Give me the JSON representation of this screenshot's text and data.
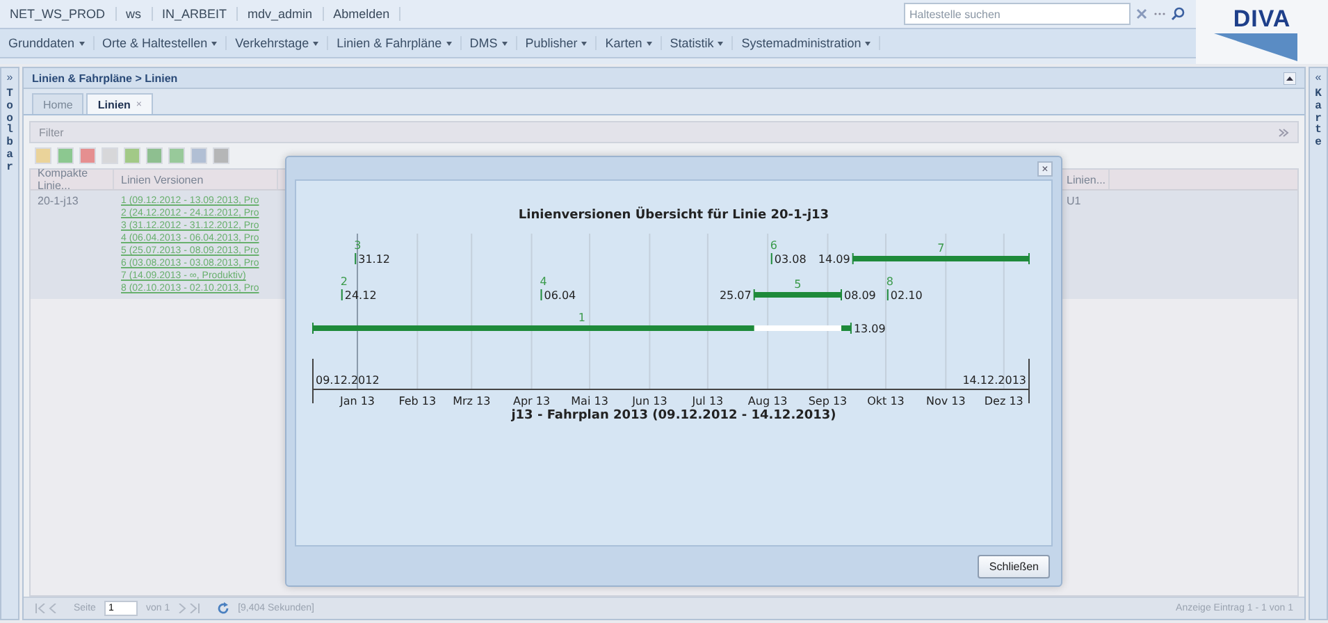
{
  "top_bar": {
    "items": [
      "NET_WS_PROD",
      "ws",
      "IN_ARBEIT",
      "mdv_admin",
      "Abmelden"
    ],
    "search": {
      "placeholder": "Haltestelle suchen"
    },
    "logo": "DIVA"
  },
  "menu": [
    "Grunddaten",
    "Orte & Haltestellen",
    "Verkehrstage",
    "Linien & Fahrpläne",
    "DMS",
    "Publisher",
    "Karten",
    "Statistik",
    "Systemadministration"
  ],
  "left_strip": {
    "toggle": "»",
    "label": "Toolbar"
  },
  "right_strip": {
    "toggle": "«",
    "label": "Karte"
  },
  "panel": {
    "breadcrumb": "Linien & Fahrpläne > Linien",
    "tabs": [
      {
        "label": "Home",
        "selected": false
      },
      {
        "label": "Linien",
        "selected": true,
        "close": "×"
      }
    ],
    "filter": "Filter",
    "grid": {
      "columns": [
        "Kompakte Linie...",
        "Linien Versionen",
        "Linien..."
      ],
      "rows": [
        {
          "compact": "20-1-j13",
          "versions": [
            "1 (09.12.2012 - 13.09.2013, Pro",
            "2 (24.12.2012 - 24.12.2012, Pro",
            "3 (31.12.2012 - 31.12.2012, Pro",
            "4 (06.04.2013 - 06.04.2013, Pro",
            "5 (25.07.2013 - 08.09.2013, Pro",
            "6 (03.08.2013 - 03.08.2013, Pro",
            "7 (14.09.2013 - ∞, Produktiv)",
            "8 (02.10.2013 - 02.10.2013, Pro"
          ],
          "column_3": "U1"
        }
      ]
    },
    "pager": {
      "page_label": "Seite",
      "page": "1",
      "of": "von 1",
      "timing": "[9,404 Sekunden]",
      "summary": "Anzeige Eintrag 1 - 1 von 1"
    }
  },
  "dialog": {
    "close": "×",
    "title": "Linienversionen Übersicht für Linie 20-1-j13",
    "button": "Schließen",
    "timeline": {
      "range_start": "09.12.2012",
      "range_end": "14.12.2013",
      "months": [
        "Jan 13",
        "Feb 13",
        "Mrz 13",
        "Apr 13",
        "Mai 13",
        "Jun 13",
        "Jul 13",
        "Aug 13",
        "Sep 13",
        "Okt 13",
        "Nov 13",
        "Dez 13"
      ],
      "caption": "j13 - Fahrplan 2013 (09.12.2012 - 14.12.2013)",
      "lanes": [
        {
          "versions": [
            {
              "number": "3",
              "kind": "point",
              "date": "31.12"
            },
            {
              "number": "6",
              "kind": "point",
              "date": "03.08"
            },
            {
              "number": "7",
              "kind": "bar",
              "start": "14.09"
            }
          ]
        },
        {
          "versions": [
            {
              "number": "2",
              "kind": "point",
              "date": "24.12"
            },
            {
              "number": "4",
              "kind": "point",
              "date": "06.04"
            },
            {
              "number": "5",
              "kind": "bar",
              "start": "25.07",
              "end": "08.09"
            },
            {
              "number": "8",
              "kind": "point",
              "date": "02.10"
            }
          ]
        },
        {
          "versions": [
            {
              "number": "1",
              "kind": "bar",
              "end": "13.09"
            }
          ]
        }
      ]
    }
  }
}
